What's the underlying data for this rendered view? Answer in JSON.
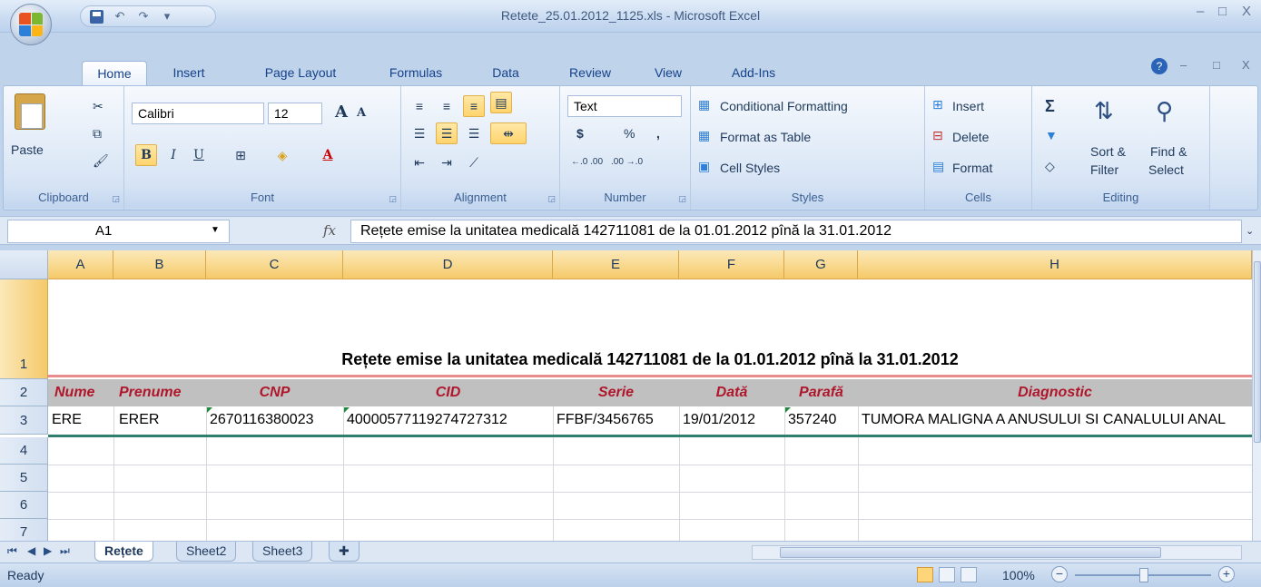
{
  "window": {
    "title": "Retete_25.01.2012_1125.xls - Microsoft Excel",
    "min": "–",
    "max": "□",
    "close": "X"
  },
  "qat": {
    "undo": "↶",
    "redo": "↷",
    "more": "▾"
  },
  "ribbon": {
    "tabs": [
      "Home",
      "Insert",
      "Page Layout",
      "Formulas",
      "Data",
      "Review",
      "View",
      "Add-Ins"
    ],
    "clipboard": {
      "paste": "Paste",
      "label": "Clipboard"
    },
    "font": {
      "name": "Calibri",
      "size": "12",
      "bold": "B",
      "italic": "I",
      "underline": "U",
      "grow": "A",
      "shrink": "A",
      "font_color": "A",
      "label": "Font"
    },
    "alignment": {
      "label": "Alignment"
    },
    "number": {
      "format": "Text",
      "currency": "$",
      "percent": "%",
      "comma": ",",
      "inc_decimal": "←.0 .00",
      "dec_decimal": ".00 →.0",
      "label": "Number"
    },
    "styles": {
      "conditional": "Conditional Formatting",
      "format_table": "Format as Table",
      "cell_styles": "Cell Styles",
      "label": "Styles"
    },
    "cells": {
      "insert": "Insert",
      "delete": "Delete",
      "format": "Format",
      "label": "Cells"
    },
    "editing": {
      "sum": "Σ",
      "sort": "Sort &",
      "filter": "Filter",
      "find": "Find &",
      "select": "Select",
      "label": "Editing"
    }
  },
  "formula_bar": {
    "name_box": "A1",
    "fx": "fx",
    "content": "Rețete emise la unitatea medicală 142711081 de la 01.01.2012 pînă la 31.01.2012"
  },
  "grid": {
    "columns": [
      "A",
      "B",
      "C",
      "D",
      "E",
      "F",
      "G",
      "H"
    ],
    "rows": [
      "1",
      "2",
      "3",
      "4",
      "5",
      "6",
      "7"
    ],
    "title": "Rețete emise la unitatea medicală 142711081 de la 01.01.2012 pînă la 31.01.2012",
    "headers": [
      "Nume",
      "Prenume",
      "CNP",
      "CID",
      "Serie",
      "Dată",
      "Parafă",
      "Diagnostic"
    ],
    "row3": [
      "ERE",
      "ERER",
      "2670116380023",
      "40000577119274727312",
      "FFBF/3456765",
      "19/01/2012",
      "357240",
      "TUMORA MALIGNA A ANUSULUI SI CANALULUI ANAL"
    ]
  },
  "sheets": [
    "Rețete",
    "Sheet2",
    "Sheet3"
  ],
  "status": {
    "text": "Ready",
    "zoom": "100%"
  },
  "colors": {
    "header_text": "#b0162b",
    "header_bg": "#c0c0c0",
    "selection": "#f5c96a"
  }
}
